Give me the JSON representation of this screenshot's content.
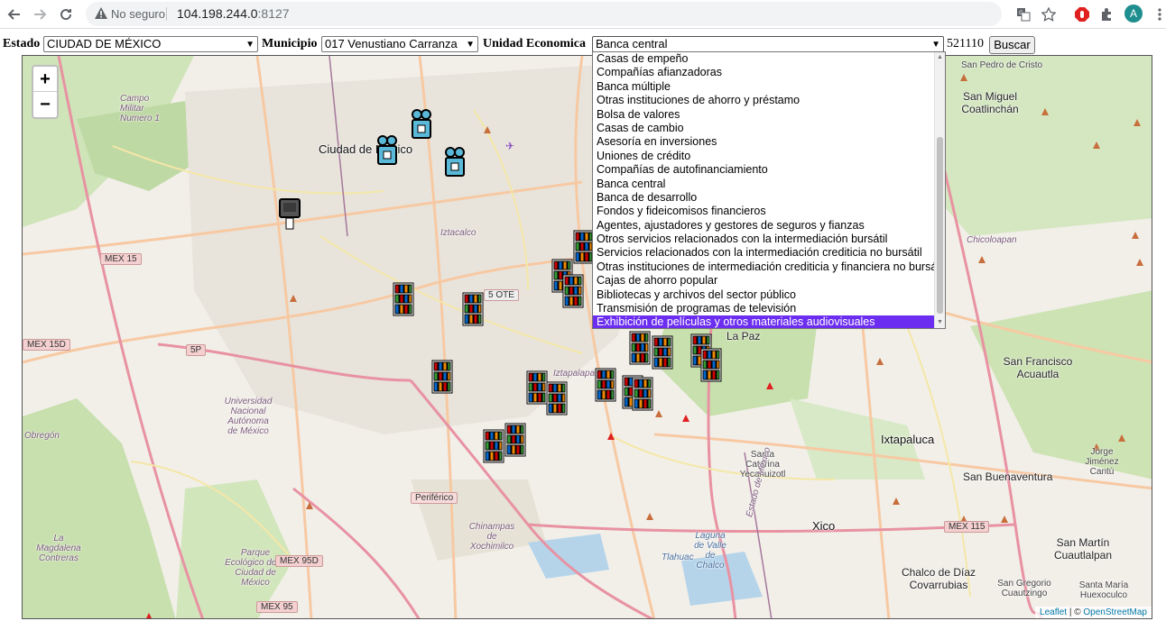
{
  "browser": {
    "security_status": "No seguro",
    "url_host": "104.198.244.0",
    "url_port": ":8127",
    "avatar_initial": "A",
    "icons": [
      "back-arrow-icon",
      "forward-arrow-icon",
      "reload-icon",
      "warning-icon",
      "translate-icon",
      "star-icon",
      "adblock-icon",
      "extensions-puzzle-icon",
      "menu-kebab-icon"
    ]
  },
  "form": {
    "estado_label": "Estado",
    "estado_value": "CIUDAD DE MÉXICO",
    "municipio_label": "Municipio",
    "municipio_value": "017 Venustiano Carranza",
    "unidad_label": "Unidad Economica",
    "unidad_value": "Banca central",
    "code": "521110",
    "search_button": "Buscar"
  },
  "unidad_options": [
    "Casas de empeño",
    "Compañías afianzadoras",
    "Banca múltiple",
    "Otras instituciones de ahorro y préstamo",
    "Bolsa de valores",
    "Casas de cambio",
    "Asesoría en inversiones",
    "Uniones de crédito",
    "Compañías de autofinanciamiento",
    "Banca central",
    "Banca de desarrollo",
    "Fondos y fideicomisos financieros",
    "Agentes, ajustadores y gestores de seguros y fianzas",
    "Otros servicios relacionados con la intermediación bursátil",
    "Servicios relacionados con la intermediación crediticia no bursátil",
    "Otras instituciones de intermediación crediticia y financiera no bursátil",
    "Cajas de ahorro popular",
    "Bibliotecas y archivos del sector público",
    "Transmisión de programas de televisión",
    "Exhibición de películas y otros materiales audiovisuales"
  ],
  "highlighted_option_index": 19,
  "map": {
    "zoom_in": "+",
    "zoom_out": "−",
    "places": {
      "ciudad_de_mexico": "Ciudad de México",
      "campo_militar": "Campo Militar Numero 1",
      "iztacalco": "Iztacalco",
      "iztapalapa": "Iztapalapa",
      "la_paz": "La Paz",
      "ixtapaluca": "Ixtapaluca",
      "xico": "Xico",
      "san_buenaventura": "San Buenaventura",
      "chalco": "Chalco de Díaz Covarrubias",
      "san_martin": "San Martín Cuautlalpan",
      "san_francisco": "San Francisco Acuautla",
      "san_miguel": "San Miguel Coatlinchán",
      "chicoloapan": "Chicoloapan",
      "santa_catarina": "Santa Catarina Yecahuizotl",
      "jorge_jimenez": "Jorge Jiménez Cantú",
      "san_gregorio": "San Gregorio Cuautzingo",
      "santa_maria": "Santa María Huexoculco",
      "unam": "Universidad Nacional Autónoma de México",
      "obregon": "Obregón",
      "magdalena": "La Magdalena Contreras",
      "parque": "Parque Ecológico de la Ciudad de México",
      "chinampas": "Chinampas de Xochimilco",
      "tlahuac": "Tlahuac",
      "laguna": "Laguna de Valle de Chalco",
      "estado_mexico": "Estado de México",
      "san_pedro": "San Pedro de Cristo",
      "periferico": "Periférico",
      "cinco_ote": "5 OTE"
    },
    "road_shields": [
      "MEX 15",
      "MEX 15D",
      "5P",
      "MEX 95D",
      "MEX 95",
      "MEX 115"
    ],
    "attribution_leaflet": "Leaflet",
    "attribution_sep": " | © ",
    "attribution_osm": "OpenStreetMap"
  }
}
